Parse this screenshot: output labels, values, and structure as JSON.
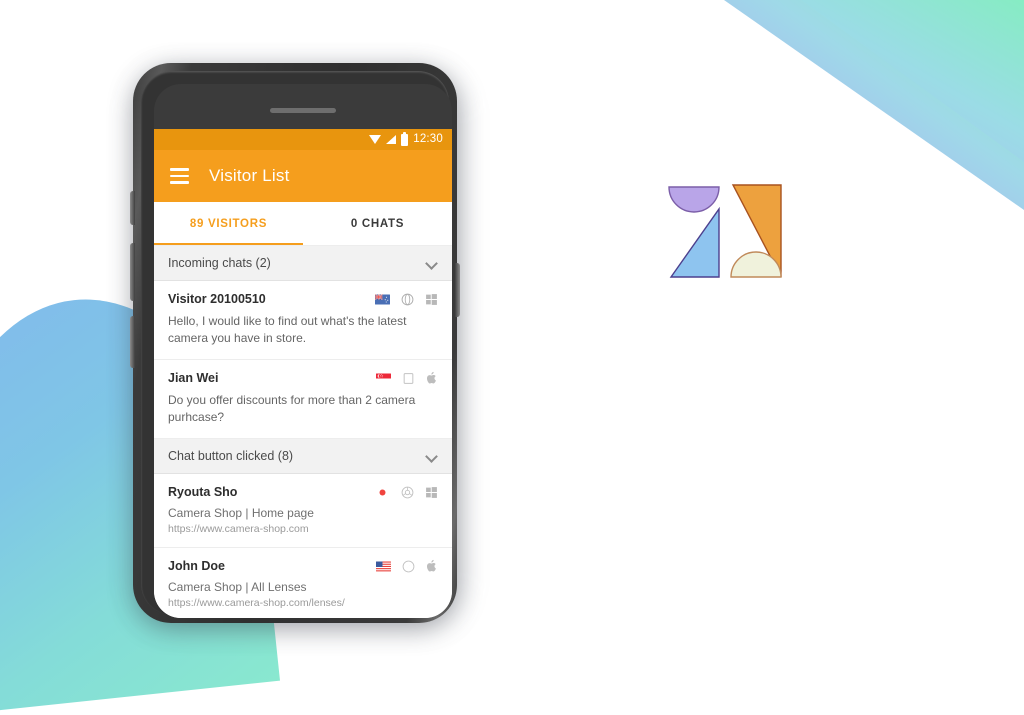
{
  "background": {
    "topright_gradient_from": "#b3aef4",
    "topright_gradient_to": "#7defc0",
    "bottomleft_gradient_from": "#82b9ec",
    "bottomleft_gradient_to": "#89e8cf",
    "page_bg": "#ffffff"
  },
  "phone": {
    "body_color": "#3a3a3a",
    "speaker": "speaker-grille"
  },
  "statusbar": {
    "time": "12:30",
    "bg": "#e8950e",
    "icons": [
      "wifi-icon",
      "signal-icon",
      "battery-icon"
    ]
  },
  "appbar": {
    "menu_icon": "hamburger-menu-icon",
    "title": "Visitor List",
    "bg": "#f59e1d"
  },
  "tabs": [
    {
      "label": "89 VISITORS",
      "active": true
    },
    {
      "label": "0 CHATS",
      "active": false
    }
  ],
  "accent_color": "#f59e1d",
  "sections": [
    {
      "title": "Incoming chats (2)",
      "chevron": "chevron-down-icon",
      "rows": [
        {
          "name": "Visitor 20100510",
          "message": "Hello, I would like to find out what's the latest camera you have in store.",
          "page": null,
          "url": null,
          "flag": "new-zealand-flag-icon",
          "browser": "opera-browser-icon",
          "os": "windows-os-icon"
        },
        {
          "name": "Jian Wei",
          "message": "Do you offer discounts for more than 2 camera purhcase?",
          "page": null,
          "url": null,
          "flag": "singapore-flag-icon",
          "browser": "safari-browser-icon",
          "os": "apple-os-icon"
        }
      ]
    },
    {
      "title": "Chat button clicked (8)",
      "chevron": "chevron-down-icon",
      "rows": [
        {
          "name": "Ryouta Sho",
          "message": null,
          "page": "Camera Shop | Home page",
          "url": "https://www.camera-shop.com",
          "flag": "japan-flag-icon",
          "browser": "chrome-browser-icon",
          "os": "windows-os-icon"
        },
        {
          "name": "John Doe",
          "message": null,
          "page": "Camera Shop | All Lenses",
          "url": "https://www.camera-shop.com/lenses/",
          "flag": "usa-flag-icon",
          "browser": "safari-browser-icon",
          "os": "apple-os-icon"
        }
      ]
    }
  ],
  "logo": {
    "name": "zendesk-logo",
    "shapes": [
      {
        "shape": "half-circle-down",
        "color": "#b9a5e8"
      },
      {
        "shape": "triangle-right",
        "color": "#eda13e"
      },
      {
        "shape": "triangle-left",
        "color": "#8ec4ef"
      },
      {
        "shape": "half-circle-up",
        "color": "#f0f2dc"
      }
    ]
  }
}
